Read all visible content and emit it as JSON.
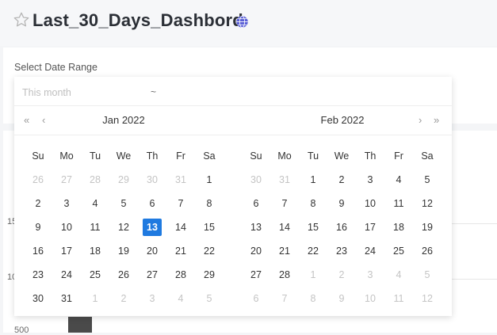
{
  "header": {
    "title": "Last_30_Days_Dashbord"
  },
  "filter": {
    "label": "Select Date Range"
  },
  "chart_axis": {
    "tick_top": "15",
    "tick_mid": "10",
    "tick_bottom": "500"
  },
  "picker": {
    "start_placeholder": "This month",
    "separator": "~",
    "end_value": "",
    "nav": {
      "prev_year": "«",
      "prev_month": "‹",
      "next_month": "›",
      "next_year": "»"
    },
    "weekdays": [
      "Su",
      "Mo",
      "Tu",
      "We",
      "Th",
      "Fr",
      "Sa"
    ],
    "months": [
      {
        "title": "Jan 2022",
        "days": [
          {
            "d": "26",
            "m": true
          },
          {
            "d": "27",
            "m": true
          },
          {
            "d": "28",
            "m": true
          },
          {
            "d": "29",
            "m": true
          },
          {
            "d": "30",
            "m": true
          },
          {
            "d": "31",
            "m": true
          },
          {
            "d": "1"
          },
          {
            "d": "2"
          },
          {
            "d": "3"
          },
          {
            "d": "4"
          },
          {
            "d": "5"
          },
          {
            "d": "6"
          },
          {
            "d": "7"
          },
          {
            "d": "8"
          },
          {
            "d": "9"
          },
          {
            "d": "10"
          },
          {
            "d": "11"
          },
          {
            "d": "12"
          },
          {
            "d": "13",
            "today": true
          },
          {
            "d": "14"
          },
          {
            "d": "15"
          },
          {
            "d": "16"
          },
          {
            "d": "17"
          },
          {
            "d": "18"
          },
          {
            "d": "19"
          },
          {
            "d": "20"
          },
          {
            "d": "21"
          },
          {
            "d": "22"
          },
          {
            "d": "23"
          },
          {
            "d": "24"
          },
          {
            "d": "25"
          },
          {
            "d": "26"
          },
          {
            "d": "27"
          },
          {
            "d": "28"
          },
          {
            "d": "29"
          },
          {
            "d": "30"
          },
          {
            "d": "31"
          },
          {
            "d": "1",
            "m": true
          },
          {
            "d": "2",
            "m": true
          },
          {
            "d": "3",
            "m": true
          },
          {
            "d": "4",
            "m": true
          },
          {
            "d": "5",
            "m": true
          }
        ]
      },
      {
        "title": "Feb 2022",
        "days": [
          {
            "d": "30",
            "m": true
          },
          {
            "d": "31",
            "m": true
          },
          {
            "d": "1"
          },
          {
            "d": "2"
          },
          {
            "d": "3"
          },
          {
            "d": "4"
          },
          {
            "d": "5"
          },
          {
            "d": "6"
          },
          {
            "d": "7"
          },
          {
            "d": "8"
          },
          {
            "d": "9"
          },
          {
            "d": "10"
          },
          {
            "d": "11"
          },
          {
            "d": "12"
          },
          {
            "d": "13"
          },
          {
            "d": "14"
          },
          {
            "d": "15"
          },
          {
            "d": "16"
          },
          {
            "d": "17"
          },
          {
            "d": "18"
          },
          {
            "d": "19"
          },
          {
            "d": "20"
          },
          {
            "d": "21"
          },
          {
            "d": "22"
          },
          {
            "d": "23"
          },
          {
            "d": "24"
          },
          {
            "d": "25"
          },
          {
            "d": "26"
          },
          {
            "d": "27"
          },
          {
            "d": "28"
          },
          {
            "d": "1",
            "m": true
          },
          {
            "d": "2",
            "m": true
          },
          {
            "d": "3",
            "m": true
          },
          {
            "d": "4",
            "m": true
          },
          {
            "d": "5",
            "m": true
          },
          {
            "d": "6",
            "m": true
          },
          {
            "d": "7",
            "m": true
          },
          {
            "d": "8",
            "m": true
          },
          {
            "d": "9",
            "m": true
          },
          {
            "d": "10",
            "m": true
          },
          {
            "d": "11",
            "m": true
          },
          {
            "d": "12",
            "m": true
          }
        ]
      }
    ]
  },
  "colors": {
    "accent": "#1f7ae0",
    "globe": "#5a5fd6",
    "bar": "#4a4a4a"
  }
}
